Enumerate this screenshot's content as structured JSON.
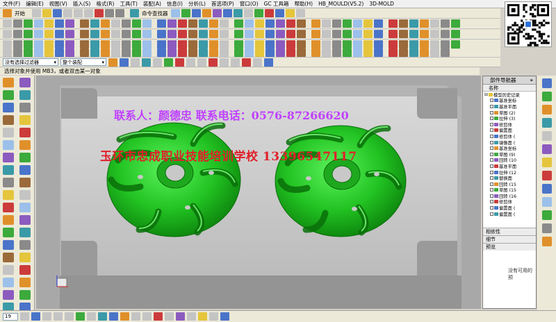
{
  "menu": [
    "文件(F)",
    "编辑(E)",
    "视图(V)",
    "插入(S)",
    "格式(R)",
    "工具(T)",
    "装配(A)",
    "信息(I)",
    "分析(L)",
    "首选项(P)",
    "窗口(O)",
    "GC 工具箱",
    "帮助(H)",
    "HB_MOULD(V5.2)",
    "3D-MOLD"
  ],
  "toolbar": {
    "start_label": "开始",
    "command_finder_label": "命令查找器"
  },
  "filter": {
    "selection_filter": "没有选择过滤器",
    "assembly_scope": "整个装配"
  },
  "status_text": "选择对象并使用 MB3，或者双击某一对象",
  "watermark": {
    "contact": "联系人：颜德忠   联系电话：0576-87266620",
    "school": "玉环市忠成职业技能培训学校   13396547117"
  },
  "navigator": {
    "title": "部件导航器",
    "column_header": "名称",
    "root": "模型历史记录",
    "items": [
      "基准坐标",
      "基准平面",
      "草图 (2)",
      "拉伸 (3)",
      "修剪体",
      "偏置面",
      "修剪体 (",
      "镜像面 (",
      "基准坐标",
      "草图 (9)",
      "回转 (10",
      "基准平面",
      "拉伸 (12",
      "替换面",
      "回转 (15",
      "草图 (15",
      "回转 (16",
      "修剪体",
      "偏置面 (",
      "偏置面 ("
    ],
    "sections": [
      "相依性",
      "细节",
      "预览"
    ],
    "preview_empty": "没有可用的预"
  },
  "zoom_value": "19",
  "colors": {
    "part_green": "#22c322",
    "viewport_bg": "#a8a8a8",
    "mold_light": "#c8c8c8",
    "watermark_purple": "#c040ff",
    "watermark_red": "#e0202a"
  }
}
